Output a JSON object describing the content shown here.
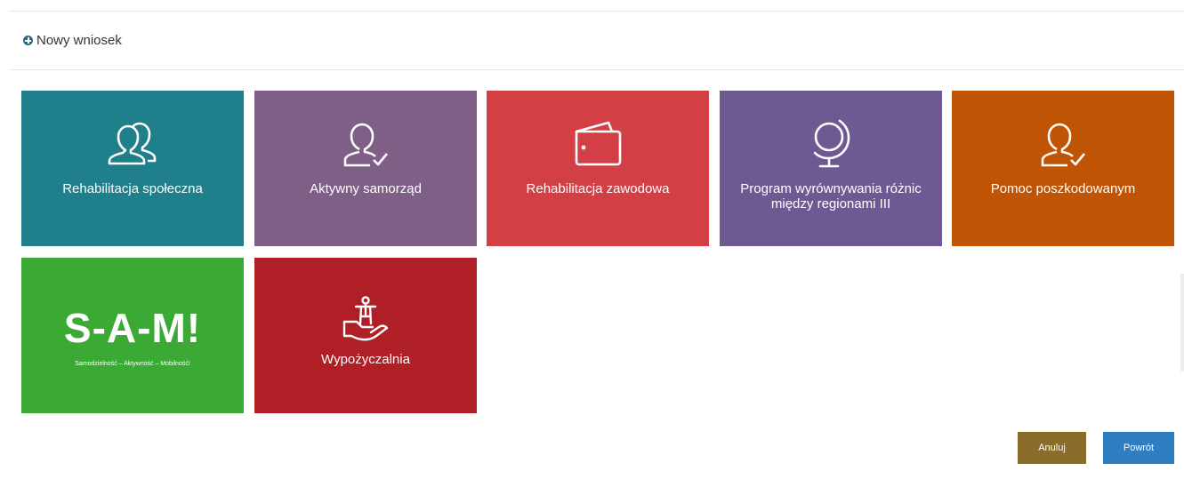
{
  "header": {
    "title": "Nowy wniosek"
  },
  "tiles": [
    {
      "label": "Rehabilitacja społeczna",
      "color": "#1f7f8a",
      "icon": "users-icon"
    },
    {
      "label": "Aktywny samorząd",
      "color": "#7f5f85",
      "icon": "user-check-icon"
    },
    {
      "label": "Rehabilitacja zawodowa",
      "color": "#d23f44",
      "icon": "wallet-icon"
    },
    {
      "label": "Program wyrównywania różnic między regionami III",
      "color": "#6e5a93",
      "icon": "globe-icon"
    },
    {
      "label": "Pomoc poszkodowanym",
      "color": "#c05405",
      "icon": "user-check-icon"
    },
    {
      "logo": "S-A-M!",
      "tagline": "Samodzielność – Aktywność – Mobilność!",
      "color": "#3aaa35",
      "icon": "sam-logo"
    },
    {
      "label": "Wypożyczalnia",
      "color": "#b01e26",
      "icon": "person-on-hand-icon"
    }
  ],
  "buttons": {
    "cancel": {
      "label": "Anuluj",
      "color": "#8b6c2b"
    },
    "back": {
      "label": "Powrót",
      "color": "#2f7ec2"
    }
  }
}
